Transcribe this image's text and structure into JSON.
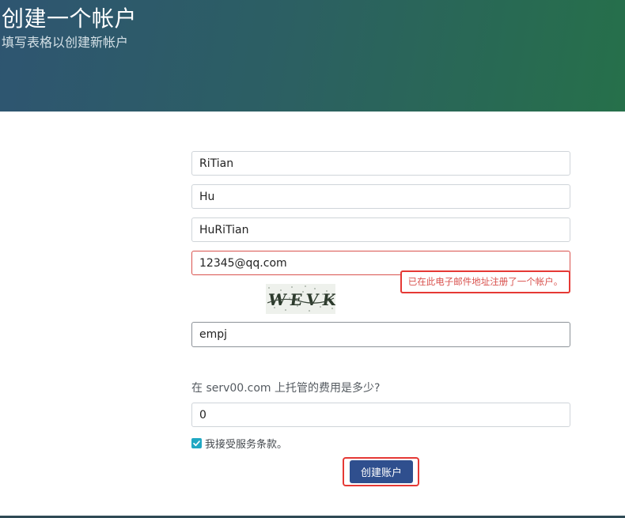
{
  "header": {
    "title": "创建一个帐户",
    "subtitle": "填写表格以创建新帐户"
  },
  "form": {
    "first_name": "RiTian",
    "last_name": "Hu",
    "username": "HuRiTian",
    "email": "12345@qq.com",
    "email_error": "已在此电子邮件地址注册了一个帐户。",
    "captcha_text": "WEVK",
    "captcha_answer": "empj",
    "question": "在 serv00.com 上托管的费用是多少?",
    "answer": "0",
    "terms_prefix": "我接受",
    "terms_link": "服务条款",
    "terms_suffix": "。",
    "terms_checked": true,
    "submit_label": "创建账户"
  },
  "colors": {
    "header_gradient_start": "#2e5571",
    "header_gradient_end": "#26704a",
    "error": "#d9534f",
    "highlight": "#e53935",
    "checkbox": "#20a8c3",
    "button": "#2f4f8e"
  },
  "icons": {
    "checkbox": "check-icon"
  }
}
